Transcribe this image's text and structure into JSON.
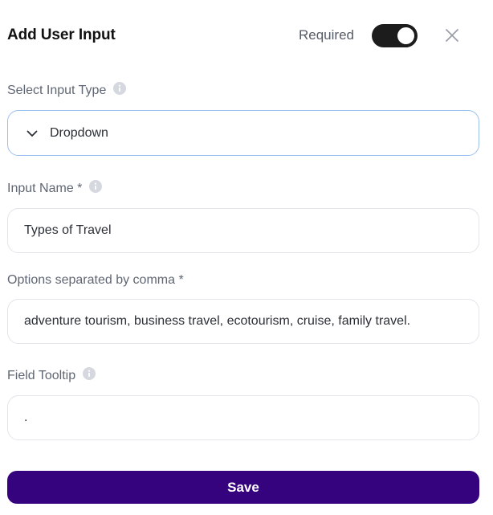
{
  "header": {
    "title": "Add User Input",
    "required_label": "Required",
    "required_on": true
  },
  "input_type": {
    "label": "Select Input Type",
    "value": "Dropdown"
  },
  "input_name": {
    "label": "Input Name *",
    "value": "Types of Travel"
  },
  "options": {
    "label": "Options separated by comma *",
    "value": "adventure tourism, business travel, ecotourism, cruise, family travel."
  },
  "tooltip": {
    "label": "Field Tooltip",
    "value": "."
  },
  "save_label": "Save",
  "colors": {
    "accent": "#36037f",
    "toggle_on": "#1c1c1c",
    "select_border": "#9cc0ec"
  }
}
